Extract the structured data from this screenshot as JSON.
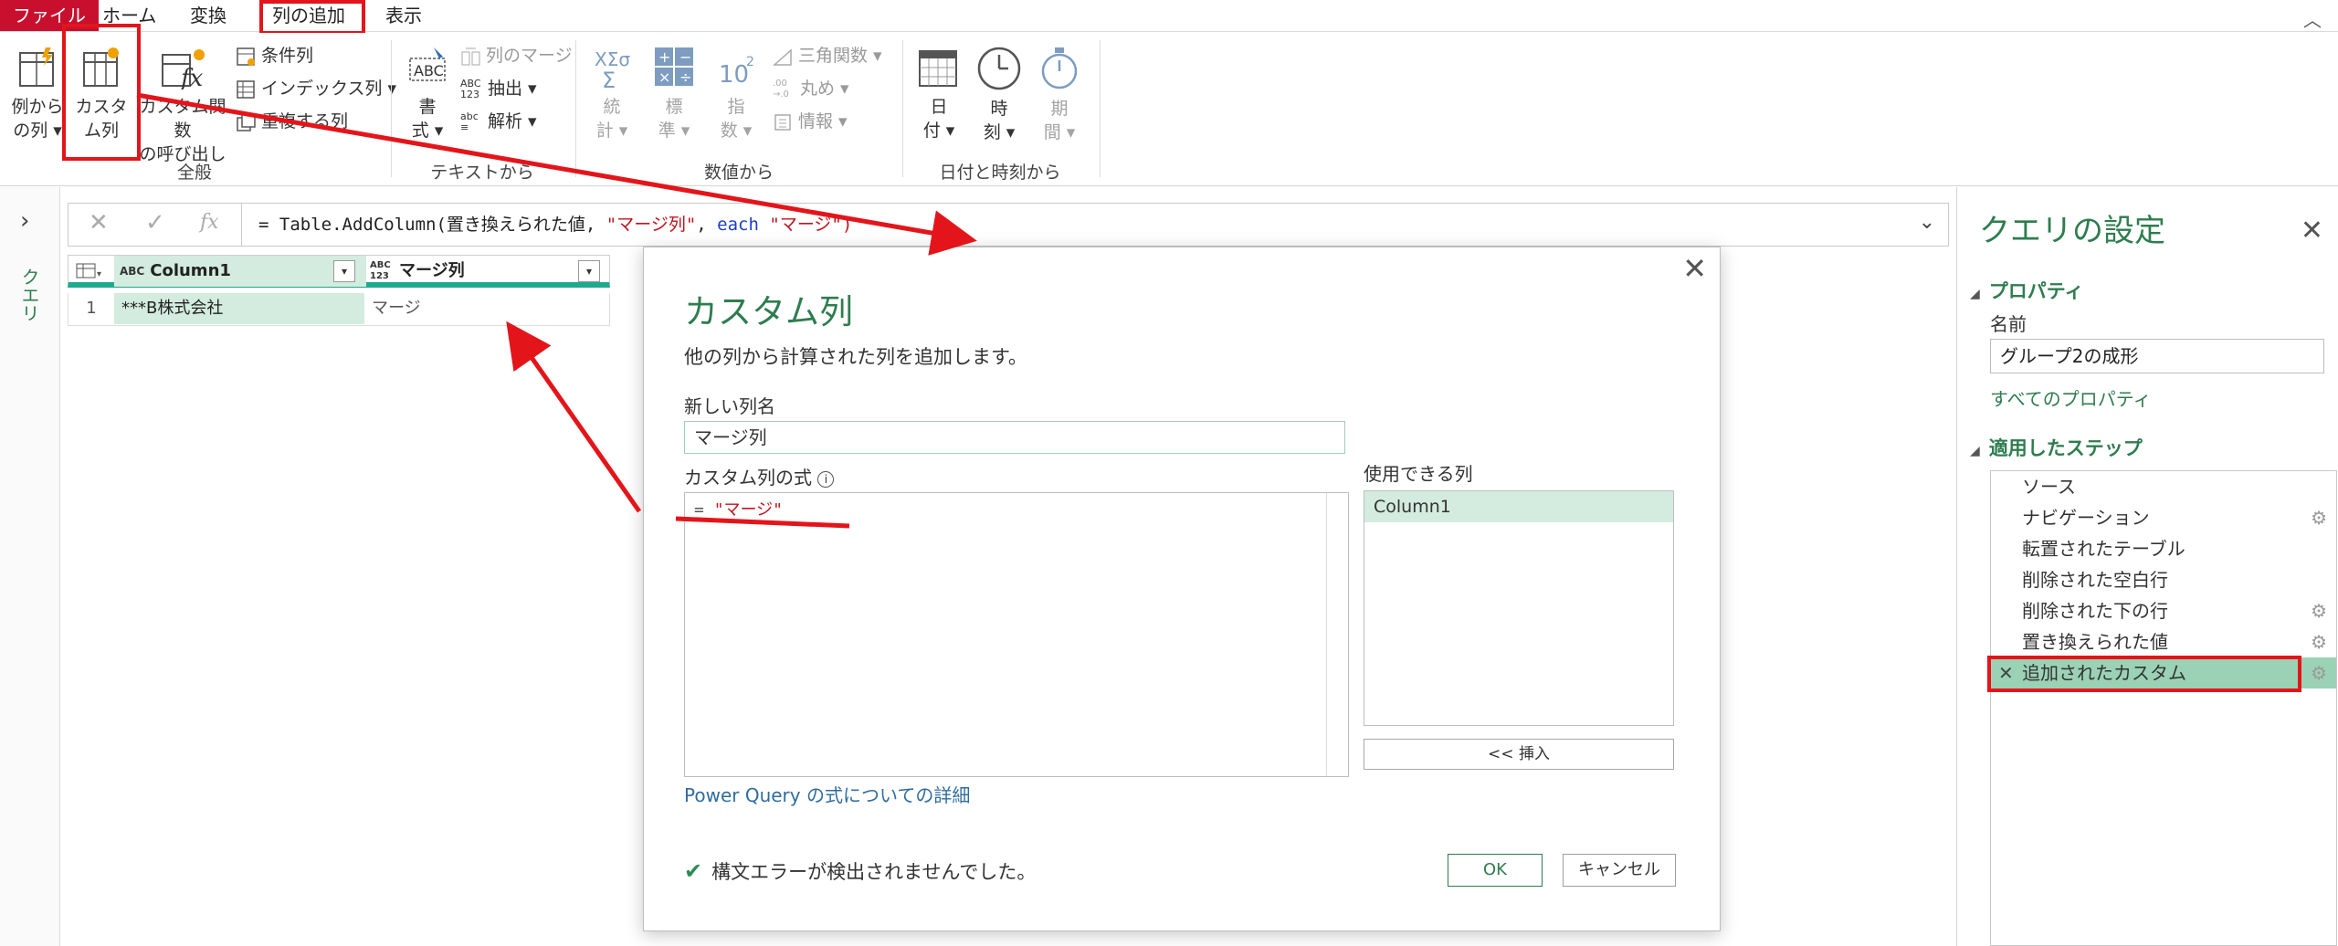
{
  "menu": {
    "file": "ファイル",
    "home": "ホーム",
    "transform": "変換",
    "add_column": "列の追加",
    "view": "表示"
  },
  "ribbon": {
    "col_from_example_1": "例から",
    "col_from_example_2": "の列",
    "custom_col_1": "カスタ",
    "custom_col_2": "ム列",
    "invoke_fn_1": "カスタム関数",
    "invoke_fn_2": "の呼び出し",
    "conditional": "条件列",
    "index": "インデックス列",
    "duplicate": "重複する列",
    "group_general": "全般",
    "format_1": "書",
    "format_2": "式",
    "merge": "列のマージ",
    "extract": "抽出",
    "parse": "解析",
    "group_text": "テキストから",
    "stats_1": "統",
    "stats_2": "計",
    "standard_1": "標",
    "standard_2": "準",
    "sci_1": "指",
    "sci_2": "数",
    "trig": "三角関数",
    "round": "丸め",
    "info": "情報",
    "group_number": "数値から",
    "date_1": "日",
    "date_2": "付",
    "time_1": "時",
    "time_2": "刻",
    "dur_1": "期",
    "dur_2": "間",
    "group_datetime": "日付と時刻から"
  },
  "left_pane": {
    "label": "クエリ"
  },
  "formula_bar": {
    "prefix": "= Table.AddColumn(置き換えられた値, ",
    "str1": "\"マージ列\"",
    "comma": ", ",
    "kw": "each",
    "str2": " \"マージ\")"
  },
  "grid": {
    "columns": [
      {
        "type": "ABC",
        "name": "Column1"
      },
      {
        "type": "ABC 123",
        "name": "マージ列"
      }
    ],
    "rows": [
      {
        "index": "1",
        "c1": "***B株式会社",
        "c2": "マージ"
      }
    ]
  },
  "settings": {
    "title": "クエリの設定",
    "properties": "プロパティ",
    "name_label": "名前",
    "name_value": "グループ2の成形",
    "all_props": "すべてのプロパティ",
    "applied_steps": "適用したステップ",
    "steps": [
      "ソース",
      "ナビゲーション",
      "転置されたテーブル",
      "削除された空白行",
      "削除された下の行",
      "置き換えられた値",
      "追加されたカスタム"
    ]
  },
  "dialog": {
    "title": "カスタム列",
    "subtitle": "他の列から計算された列を追加します。",
    "new_col_label": "新しい列名",
    "new_col_value": "マージ列",
    "formula_label": "カスタム列の式",
    "formula_eq": "= ",
    "formula_value": "\"マージ\"",
    "available_label": "使用できる列",
    "available_items": [
      "Column1"
    ],
    "insert": "<< 挿入",
    "learn_more": "Power Query の式についての詳細",
    "status": "構文エラーが検出されませんでした。",
    "ok": "OK",
    "cancel": "キャンセル"
  },
  "colors": {
    "accent_green": "#2e7d4f",
    "annotation_red": "#e3151a",
    "file_tab": "#c8102e"
  }
}
